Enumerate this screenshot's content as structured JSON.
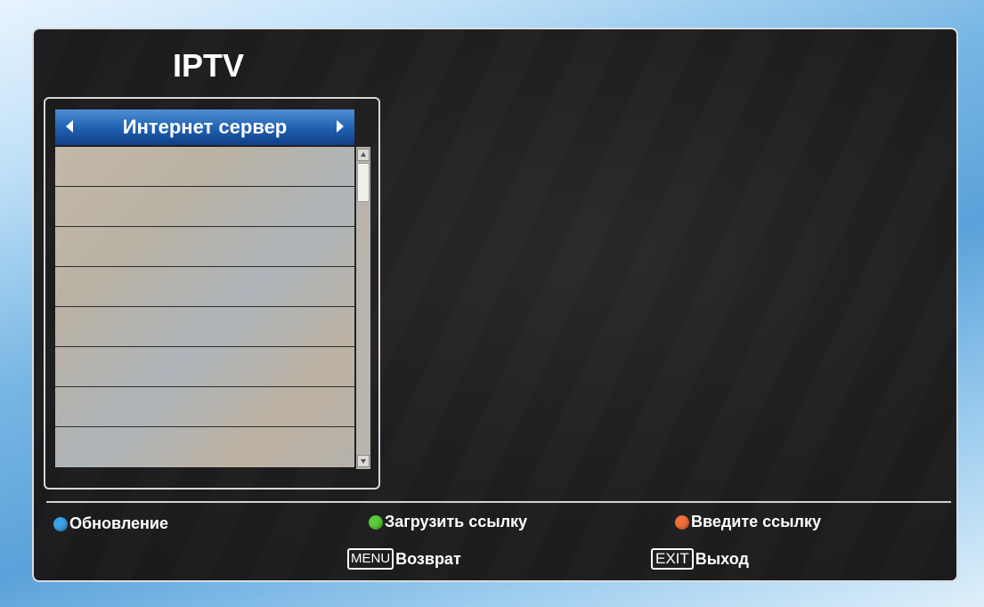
{
  "screen": {
    "title": "IPTV"
  },
  "list": {
    "header": "Интернет сервер",
    "row_count": 8
  },
  "legend": {
    "blue": {
      "label": "Обновление",
      "color": "#3aa3e8",
      "icon": "blue-dot-icon"
    },
    "green": {
      "label": "Загрузить ссылку",
      "color": "#5cc93a",
      "icon": "green-dot-icon"
    },
    "red": {
      "label": "Введите ссылку",
      "color": "#f0703a",
      "icon": "red-dot-icon"
    }
  },
  "keys": {
    "menu": {
      "key": "MENU",
      "label": "Возврат"
    },
    "exit": {
      "key": "EXIT",
      "label": "Выход"
    }
  }
}
